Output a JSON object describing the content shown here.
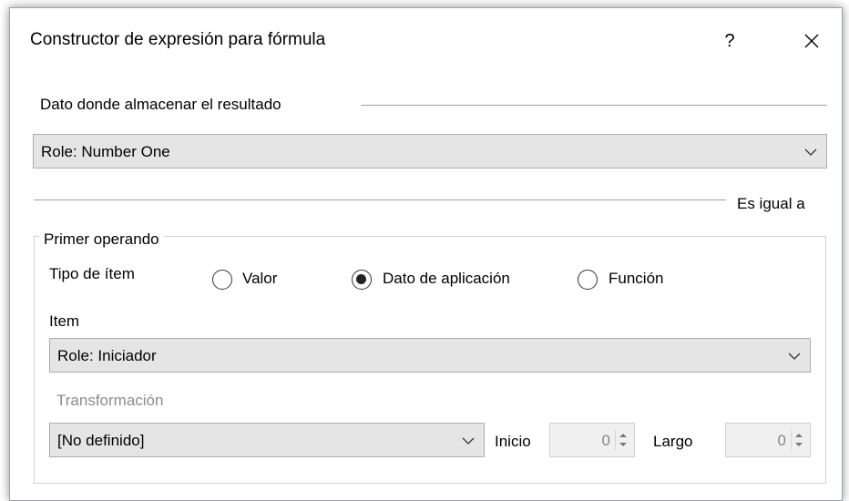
{
  "dialog": {
    "title": "Constructor de expresión para fórmula",
    "help_label": "?"
  },
  "target": {
    "section_label": "Dato donde almacenar el resultado",
    "selected": "Role: Number One"
  },
  "operator_label": "Es igual a",
  "first_operand": {
    "group_title": "Primer operando",
    "item_type_label": "Tipo de ítem",
    "options": [
      {
        "label": "Valor",
        "checked": false
      },
      {
        "label": "Dato de aplicación",
        "checked": true
      },
      {
        "label": "Función",
        "checked": false
      }
    ],
    "item_label": "Item",
    "item_selected": "Role: Iniciador",
    "transform_label": "Transformación",
    "transform_selected": "[No definido]",
    "start_label": "Inicio",
    "start_value": "0",
    "length_label": "Largo",
    "length_value": "0"
  }
}
